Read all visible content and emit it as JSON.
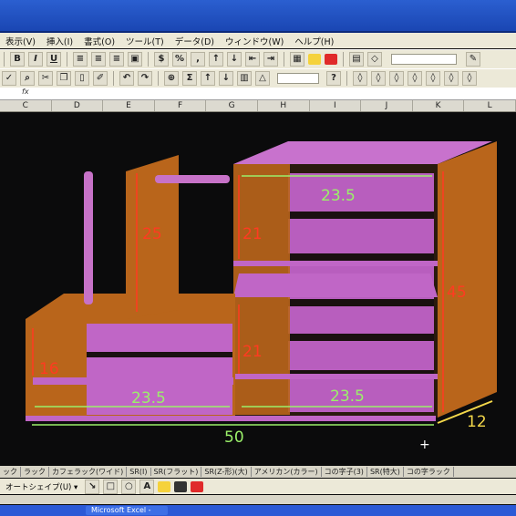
{
  "menu": {
    "items": [
      "表示(V)",
      "挿入(I)",
      "書式(O)",
      "ツール(T)",
      "データ(D)",
      "ウィンドウ(W)",
      "ヘルプ(H)"
    ]
  },
  "formula": {
    "fx": "fx",
    "value": ""
  },
  "columns": [
    "C",
    "D",
    "E",
    "F",
    "G",
    "H",
    "I",
    "J",
    "K",
    "L"
  ],
  "drawing": {
    "dimensions": {
      "left_shelf_height": "25",
      "right_top_height": "21",
      "right_mid_height": "21",
      "left_lower_height": "16",
      "right_total_height": "45",
      "top_width": "23.5",
      "left_bottom_width": "23.5",
      "right_bottom_width": "23.5",
      "total_width": "50",
      "depth": "12"
    },
    "colors": {
      "wood": "#b9651b",
      "panel": "#c066c6",
      "dim_red": "#ff3b21",
      "dim_green": "#9bf06a",
      "dim_yellow": "#f3d74a"
    }
  },
  "tabs": [
    "ック",
    "ラック",
    "カフェラック(ワイド)",
    "SR(I)",
    "SR(フラット)",
    "SR(Z-形)(大)",
    "アメリカン(カラー)",
    "コの字子(3)",
    "SR(特大)",
    "コの字ラック"
  ],
  "drawbar": {
    "autoshape_label": "オートシェイプ(U) ▾"
  },
  "taskbar": {
    "window_label": "Microsoft Excel -"
  }
}
